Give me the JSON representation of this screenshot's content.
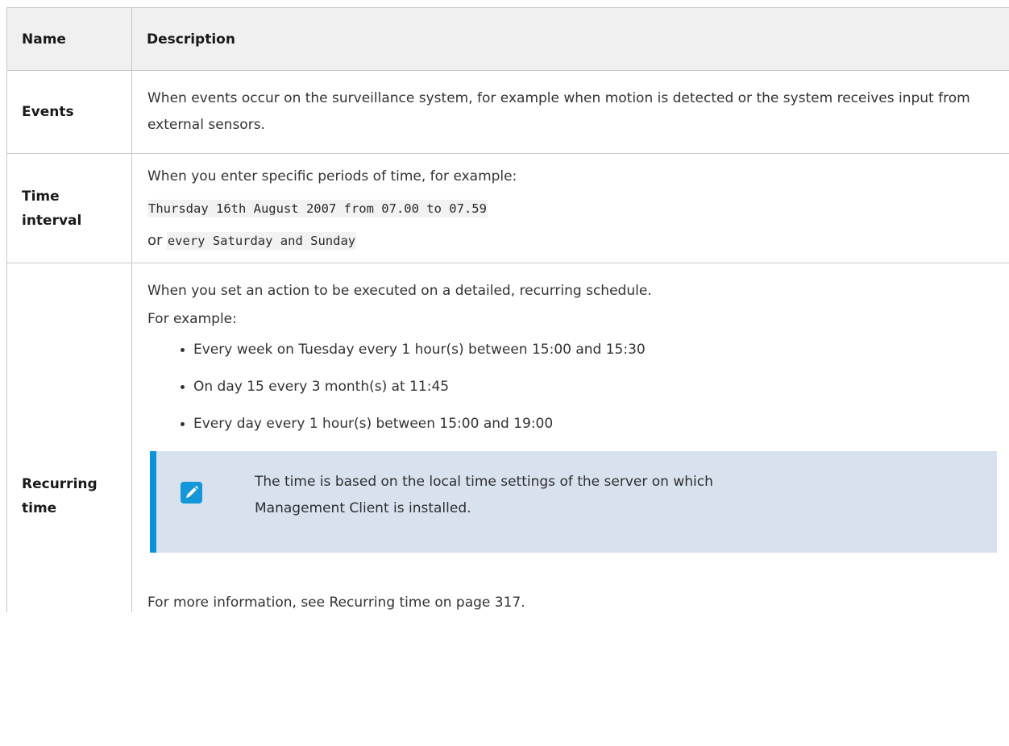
{
  "header": {
    "name": "Name",
    "description": "Description"
  },
  "rows": [
    {
      "name": "Events",
      "description": "When events occur on the surveillance system, for example when motion is detected or the system receives input from external sensors."
    },
    {
      "name_line1": "Time",
      "name_line2": "interval",
      "intro": "When you enter specific periods of time, for example:",
      "example1": "Thursday 16th August 2007 from 07.00 to 07.59",
      "or_word": "or",
      "example2": "every Saturday and Sunday"
    },
    {
      "name_line1": "Recurring",
      "name_line2": "time",
      "intro": "When you set an action to be executed on a detailed, recurring schedule.",
      "for_example": "For example:",
      "items": [
        "Every week on Tuesday every 1 hour(s) between 15:00 and 15:30",
        "On day 15 every 3 month(s) at 11:45",
        "Every day every 1 hour(s) between 15:00 and 19:00"
      ],
      "note": {
        "icon": "pencil-icon",
        "line1": "The time is based on the local time settings of the server on which",
        "line2": "Management Client is installed."
      },
      "more_info": "For more information, see Recurring time on page 317."
    }
  ],
  "colors": {
    "note_background": "#d8e2ef",
    "note_accent": "#0a93d6"
  }
}
